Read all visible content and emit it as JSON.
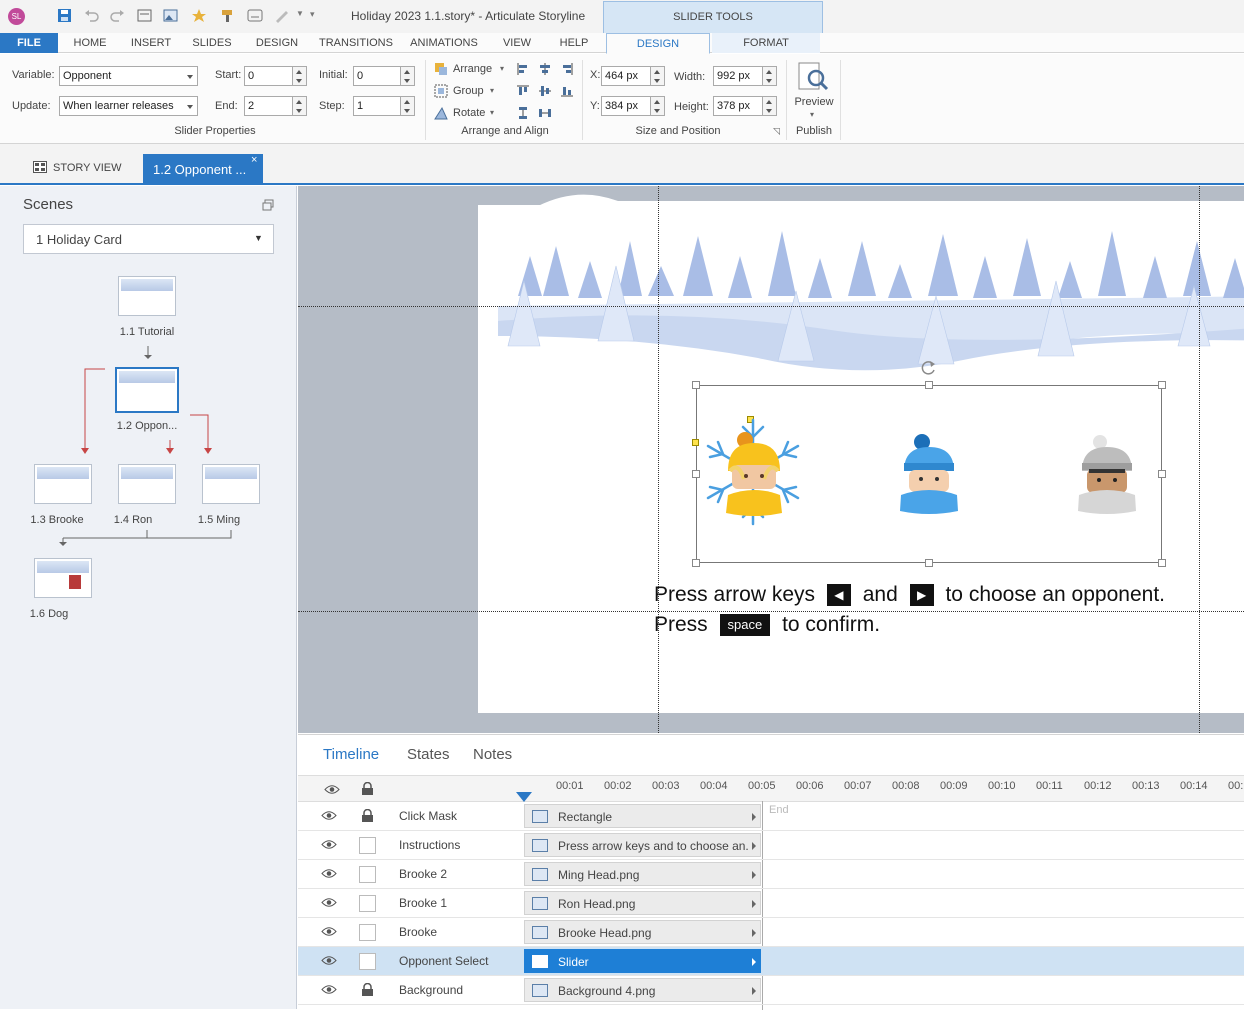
{
  "window": {
    "title": "Holiday 2023 1.1.story* - Articulate Storyline",
    "app_icon": "SL"
  },
  "contextual_tab_group": {
    "label": "SLIDER TOOLS"
  },
  "menu_tabs": [
    {
      "label": "FILE"
    },
    {
      "label": "HOME"
    },
    {
      "label": "INSERT"
    },
    {
      "label": "SLIDES"
    },
    {
      "label": "DESIGN"
    },
    {
      "label": "TRANSITIONS"
    },
    {
      "label": "ANIMATIONS"
    },
    {
      "label": "VIEW"
    },
    {
      "label": "HELP"
    },
    {
      "label": "DESIGN"
    },
    {
      "label": "FORMAT"
    }
  ],
  "ribbon": {
    "slider_properties": {
      "variable_label": "Variable:",
      "variable_value": "Opponent",
      "update_label": "Update:",
      "update_value": "When learner releases",
      "start_label": "Start:",
      "start_value": "0",
      "end_label": "End:",
      "end_value": "2",
      "initial_label": "Initial:",
      "initial_value": "0",
      "step_label": "Step:",
      "step_value": "1",
      "group_label": "Slider Properties"
    },
    "arrange_align": {
      "arrange": "Arrange",
      "group": "Group",
      "rotate": "Rotate",
      "group_label": "Arrange and Align"
    },
    "size_position": {
      "x_label": "X:",
      "x_value": "464 px",
      "y_label": "Y:",
      "y_value": "384 px",
      "width_label": "Width:",
      "width_value": "992 px",
      "height_label": "Height:",
      "height_value": "378 px",
      "group_label": "Size and Position"
    },
    "publish": {
      "preview": "Preview",
      "group_label": "Publish"
    }
  },
  "doc_tabs": {
    "story_view": "STORY VIEW",
    "active": "1.2 Opponent ..."
  },
  "scenes": {
    "title": "Scenes",
    "selected_scene": "1 Holiday Card",
    "slides": [
      {
        "label": "1.1 Tutorial"
      },
      {
        "label": "1.2 Oppon..."
      },
      {
        "label": "1.3 Brooke"
      },
      {
        "label": "1.4 Ron"
      },
      {
        "label": "1.5 Ming"
      },
      {
        "label": "1.6 Dog"
      }
    ]
  },
  "slide": {
    "instruction_line1_a": "Press arrow keys",
    "instruction_line1_b": "and",
    "instruction_line1_c": "to choose an opponent.",
    "instruction_line2_a": "Press",
    "space_key": "space",
    "instruction_line2_b": "to confirm."
  },
  "timeline_tabs": [
    {
      "label": "Timeline"
    },
    {
      "label": "States"
    },
    {
      "label": "Notes"
    }
  ],
  "timeline": {
    "ticks": [
      "00:01",
      "00:02",
      "00:03",
      "00:04",
      "00:05",
      "00:06",
      "00:07",
      "00:08",
      "00:09",
      "00:10",
      "00:11",
      "00:12",
      "00:13",
      "00:14",
      "00:"
    ],
    "end_label": "End",
    "layers": [
      {
        "name": "Click Mask",
        "object": "Rectangle",
        "locked": true,
        "selected": false
      },
      {
        "name": "Instructions",
        "object": "Press arrow keys and to choose an...",
        "locked": false,
        "selected": false
      },
      {
        "name": "Brooke 2",
        "object": "Ming Head.png",
        "locked": false,
        "selected": false
      },
      {
        "name": "Brooke 1",
        "object": "Ron Head.png",
        "locked": false,
        "selected": false
      },
      {
        "name": "Brooke",
        "object": "Brooke Head.png",
        "locked": false,
        "selected": false
      },
      {
        "name": "Opponent Select",
        "object": "Slider",
        "locked": false,
        "selected": true
      },
      {
        "name": "Background",
        "object": "Background 4.png",
        "locked": true,
        "selected": false
      }
    ]
  },
  "colors": {
    "accent": "#2b78c5",
    "selected_row": "#cfe2f3",
    "slider_bar": "#1e7fd6"
  }
}
